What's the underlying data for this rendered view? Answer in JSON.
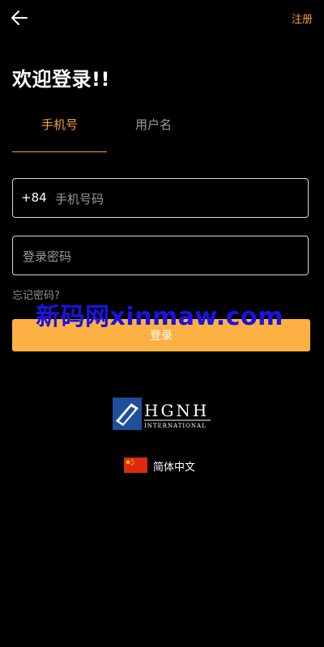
{
  "header": {
    "back_icon": "arrow-left-icon",
    "register_label": "注册"
  },
  "title": "欢迎登录!!",
  "tabs": [
    {
      "label": "手机号",
      "active": true
    },
    {
      "label": "用户名",
      "active": false
    }
  ],
  "phone_field": {
    "country_code": "+84",
    "placeholder": "手机号码",
    "value": ""
  },
  "password_field": {
    "placeholder": "登录密码",
    "value": ""
  },
  "forgot_password_label": "忘记密码?",
  "login_button_label": "登录",
  "watermark_text": "新码网xinmaw.com",
  "logo": {
    "name": "HGNH",
    "subtext": "INTERNATIONAL"
  },
  "language": {
    "flag": "china-flag-icon",
    "label": "简体中文"
  },
  "colors": {
    "accent": "#f6a13a",
    "button": "#fdb142",
    "background": "#000000",
    "watermark": "#1c12e6"
  }
}
